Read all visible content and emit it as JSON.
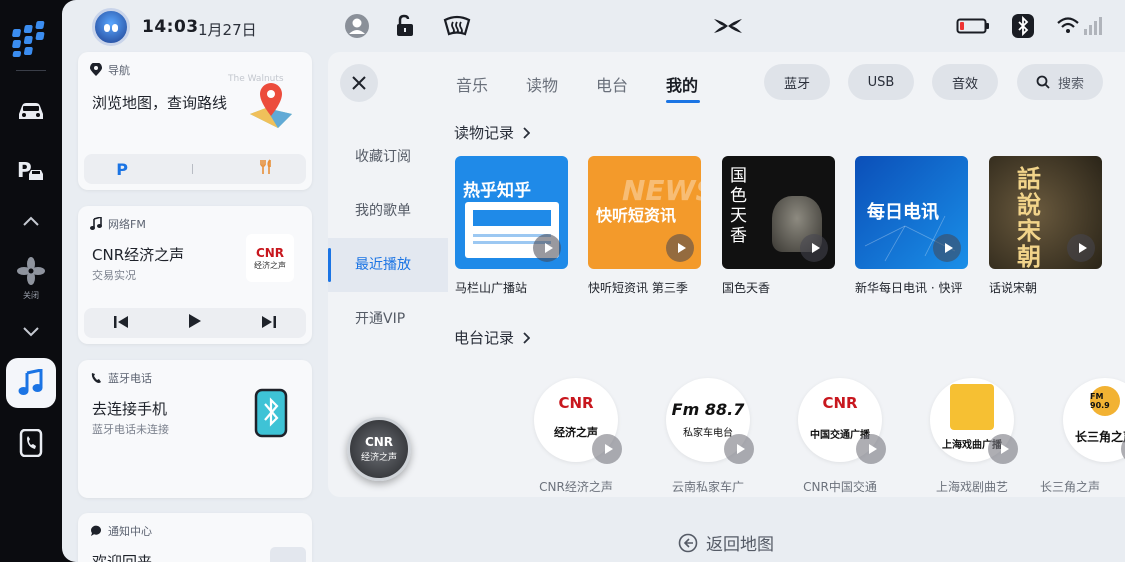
{
  "status": {
    "time": "14:03",
    "date": "1月27日"
  },
  "dock": {
    "fan_label": "关闭"
  },
  "cards": {
    "nav": {
      "head": "导航",
      "title": "浏览地图，查询路线",
      "parking_label": "P",
      "map_bg_text": "The Walnuts"
    },
    "fm": {
      "head": "网络FM",
      "title": "CNR经济之声",
      "subtitle": "交易实况",
      "logo_top": "CNR",
      "logo_bottom": "经济之声"
    },
    "phone": {
      "head": "蓝牙电话",
      "title": "去连接手机",
      "subtitle": "蓝牙电话未连接"
    },
    "notice": {
      "head": "通知中心",
      "title": "欢迎回来"
    }
  },
  "disc": {
    "line1": "CNR",
    "line2": "经济之声"
  },
  "panel": {
    "tabs": [
      {
        "label": "音乐"
      },
      {
        "label": "读物"
      },
      {
        "label": "电台"
      },
      {
        "label": "我的"
      }
    ],
    "pills": {
      "bluetooth": "蓝牙",
      "usb": "USB",
      "effects": "音效",
      "search": "搜索"
    },
    "side": [
      {
        "label": "收藏订阅"
      },
      {
        "label": "我的歌单"
      },
      {
        "label": "最近播放"
      },
      {
        "label": "开通VIP"
      }
    ],
    "reading_title": "读物记录",
    "station_title": "电台记录",
    "reading": [
      {
        "label": "马栏山广播站",
        "cover_text": "热乎知乎"
      },
      {
        "label": "快听短资讯 第三季",
        "cover_text": "快听短资讯",
        "cover_sub": "NEWS"
      },
      {
        "label": "国色天香",
        "cover_text": "国色天香"
      },
      {
        "label": "新华每日电讯 · 快评",
        "cover_text": "每日电讯"
      },
      {
        "label": "话说宋朝",
        "cover_text": "話說宋朝"
      }
    ],
    "stations": [
      {
        "label": "CNR经济之声",
        "logo": "CNR",
        "logo_sub": "经济之声"
      },
      {
        "label": "云南私家车广",
        "logo": "Fm 88.7",
        "logo_sub": "私家车电台"
      },
      {
        "label": "CNR中国交通",
        "logo": "CNR",
        "logo_sub": "中国交通广播"
      },
      {
        "label": "上海戏剧曲艺",
        "logo": "上海戏曲广播",
        "logo_sub": ""
      },
      {
        "label": "长三角之声",
        "logo": "FM 90.9",
        "logo_sub": "长三角之声"
      }
    ]
  },
  "back_map": "返回地图",
  "colors": {
    "accent": "#1b74e4",
    "dock_bg": "#0b0c10",
    "screen_bg": "#e9edf2"
  }
}
